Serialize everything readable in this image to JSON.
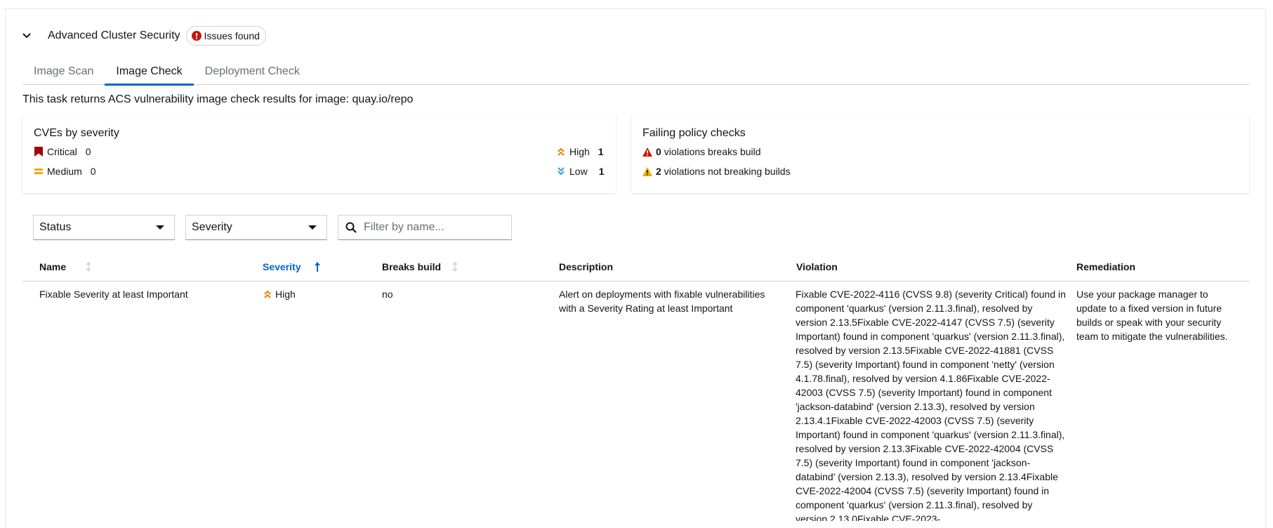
{
  "section": {
    "title": "Advanced Cluster Security",
    "badge": "Issues found"
  },
  "tabs": [
    {
      "label": "Image Scan",
      "active": false
    },
    {
      "label": "Image Check",
      "active": true
    },
    {
      "label": "Deployment Check",
      "active": false
    }
  ],
  "intro": "This task returns ACS vulnerability image check results for image: quay.io/repo",
  "cves": {
    "title": "CVEs by severity",
    "critical": {
      "label": "Critical",
      "count": "0",
      "icon": "critical-flag-icon",
      "color": "#a30000"
    },
    "medium": {
      "label": "Medium",
      "count": "0",
      "icon": "medium-equals-icon",
      "color": "#f0ab00"
    },
    "high": {
      "label": "High",
      "count": "1",
      "icon": "high-angle-double-up-icon",
      "color": "#ec7a08"
    },
    "low": {
      "label": "Low",
      "count": "1",
      "icon": "low-angle-double-down-icon",
      "color": "#2b9af3"
    }
  },
  "policy": {
    "title": "Failing policy checks",
    "breaking": {
      "count": "0",
      "label": "violations breaks build",
      "color": "#c9190b"
    },
    "not_breaking": {
      "count": "2",
      "label": "violations not breaking builds",
      "color": "#f0ab00"
    }
  },
  "toolbar": {
    "status_label": "Status",
    "severity_label": "Severity",
    "filter_placeholder": "Filter by name..."
  },
  "table": {
    "headers": {
      "name": "Name",
      "severity": "Severity",
      "breaks_build": "Breaks build",
      "description": "Description",
      "violation": "Violation",
      "remediation": "Remediation"
    },
    "rows": [
      {
        "name": "Fixable Severity at least Important",
        "severity": "High",
        "breaks_build": "no",
        "description": "Alert on deployments with fixable vulnerabilities with a Severity Rating at least Important",
        "violation": "Fixable CVE-2022-4116 (CVSS 9.8) (severity Critical) found in component 'quarkus' (version 2.11.3.final), resolved by version 2.13.5Fixable CVE-2022-4147 (CVSS 7.5) (severity Important) found in component 'quarkus' (version 2.11.3.final), resolved by version 2.13.5Fixable CVE-2022-41881 (CVSS 7.5) (severity Important) found in component 'netty' (version 4.1.78.final), resolved by version 4.1.86Fixable CVE-2022-42003 (CVSS 7.5) (severity Important) found in component 'jackson-databind' (version 2.13.3), resolved by version 2.13.4.1Fixable CVE-2022-42003 (CVSS 7.5) (severity Important) found in component 'quarkus' (version 2.11.3.final), resolved by version 2.13.3Fixable CVE-2022-42004 (CVSS 7.5) (severity Important) found in component 'jackson-databind' (version 2.13.3), resolved by version 2.13.4Fixable CVE-2022-42004 (CVSS 7.5) (severity Important) found in component 'quarkus' (version 2.11.3.final), resolved by version 2.13.0Fixable CVE-2023-",
        "remediation": "Use your package manager to update to a fixed version in future builds or speak with your security team to mitigate the vulnerabilities."
      }
    ]
  }
}
